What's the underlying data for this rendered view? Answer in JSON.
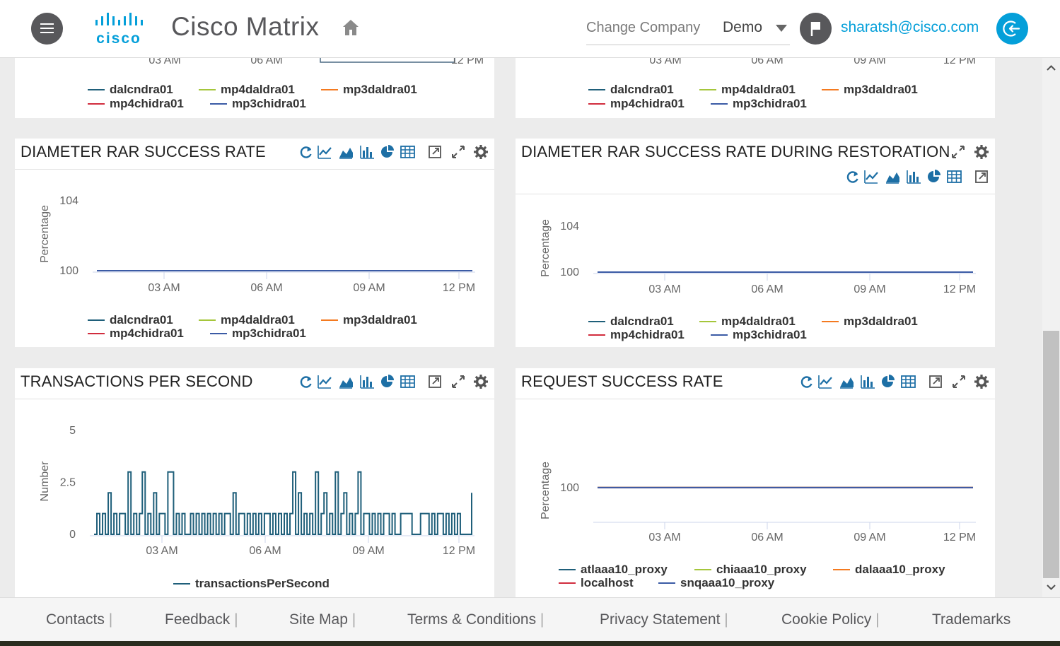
{
  "header": {
    "app_title": "Cisco Matrix",
    "logo_text": "cisco",
    "company_label": "Change Company",
    "company_value": "Demo",
    "user_email": "sharatsh@cisco.com"
  },
  "panels": {
    "top_left": {
      "legend": [
        "dalcndra01",
        "mp4daldra01",
        "mp3daldra01",
        "mp4chidra01",
        "mp3chidra01"
      ],
      "x_ticks_partial": [
        "03 AM",
        "06 AM",
        "09 AM",
        "12 PM"
      ]
    },
    "top_right": {
      "legend": [
        "dalcndra01",
        "mp4daldra01",
        "mp3daldra01",
        "mp4chidra01",
        "mp3chidra01"
      ],
      "x_ticks_partial": [
        "03 AM",
        "06 AM",
        "09 AM",
        "12 PM"
      ]
    },
    "rar_success": {
      "title": "DIAMETER RAR SUCCESS RATE",
      "legend": [
        "dalcndra01",
        "mp4daldra01",
        "mp3daldra01",
        "mp4chidra01",
        "mp3chidra01"
      ]
    },
    "rar_restoration": {
      "title": "DIAMETER RAR SUCCESS RATE DURING RESTORATION",
      "legend": [
        "dalcndra01",
        "mp4daldra01",
        "mp3daldra01",
        "mp4chidra01",
        "mp3chidra01"
      ]
    },
    "tps": {
      "title": "TRANSACTIONS PER SECOND",
      "legend": [
        "transactionsPerSecond"
      ]
    },
    "request_success": {
      "title": "REQUEST SUCCESS RATE",
      "legend": [
        "atlaaa10_proxy",
        "chiaaa10_proxy",
        "dalaaa10_proxy",
        "localhost",
        "snqaaa10_proxy"
      ]
    }
  },
  "chart_data": [
    {
      "type": "line",
      "ylabel": "Percentage",
      "x_ticks": [
        "03 AM",
        "06 AM",
        "09 AM",
        "12 PM"
      ],
      "y_ticks": [
        100,
        104
      ],
      "ylim": [
        100,
        104
      ],
      "series": [
        {
          "name": "dalcndra01",
          "color": "#1f5f7a",
          "values": [
            100,
            100
          ]
        },
        {
          "name": "mp4daldra01",
          "color": "#a5c63b",
          "values": [
            100,
            100
          ]
        },
        {
          "name": "mp3daldra01",
          "color": "#f47a20",
          "values": [
            100,
            100
          ]
        },
        {
          "name": "mp4chidra01",
          "color": "#d12d3e",
          "values": [
            100,
            100
          ]
        },
        {
          "name": "mp3chidra01",
          "color": "#3b5ba5",
          "values": [
            100,
            100
          ]
        }
      ]
    },
    {
      "type": "line",
      "ylabel": "Percentage",
      "x_ticks": [
        "03 AM",
        "06 AM",
        "09 AM",
        "12 PM"
      ],
      "y_ticks": [
        100,
        104
      ],
      "ylim": [
        100,
        104
      ],
      "series": [
        {
          "name": "dalcndra01",
          "color": "#1f5f7a",
          "values": [
            100,
            100
          ]
        },
        {
          "name": "mp4daldra01",
          "color": "#a5c63b",
          "values": [
            100,
            100
          ]
        },
        {
          "name": "mp3daldra01",
          "color": "#f47a20",
          "values": [
            100,
            100
          ]
        },
        {
          "name": "mp4chidra01",
          "color": "#d12d3e",
          "values": [
            100,
            100
          ]
        },
        {
          "name": "mp3chidra01",
          "color": "#3b5ba5",
          "values": [
            100,
            100
          ]
        }
      ]
    },
    {
      "type": "line",
      "ylabel": "Number",
      "x_ticks": [
        "03 AM",
        "06 AM",
        "09 AM",
        "12 PM"
      ],
      "y_ticks": [
        "0",
        "2.5",
        "5"
      ],
      "ylim": [
        0,
        5
      ],
      "series": [
        {
          "name": "transactionsPerSecond",
          "color": "#1f5f7a",
          "values": [
            0,
            1,
            0,
            1,
            0,
            2,
            0,
            1,
            0,
            1,
            1,
            0,
            3,
            0,
            1,
            0,
            1,
            3,
            0,
            1,
            0,
            2,
            0,
            1,
            1,
            0,
            3,
            3,
            0,
            1,
            0,
            1,
            0,
            0,
            1,
            0,
            1,
            0,
            1,
            0,
            1,
            0,
            1,
            0,
            1,
            0,
            1,
            1,
            0,
            2,
            0,
            1,
            1,
            0,
            1,
            0,
            1,
            0,
            1,
            0,
            1,
            1,
            0,
            1,
            0,
            1,
            0,
            1,
            0,
            1,
            3,
            0,
            2,
            0,
            1,
            0,
            1,
            0,
            3,
            0,
            1,
            2,
            0,
            1,
            0,
            3,
            0,
            1,
            2,
            0,
            1,
            0,
            1,
            3,
            0,
            1,
            1,
            0,
            1,
            0,
            1,
            0,
            1,
            1,
            0,
            1,
            0,
            0,
            1,
            1,
            1,
            1,
            0,
            0,
            0,
            1,
            1,
            1,
            0,
            1,
            0,
            1,
            1,
            0,
            1,
            0,
            1,
            0,
            1,
            0,
            0,
            0,
            0,
            2
          ]
        }
      ]
    },
    {
      "type": "line",
      "ylabel": "Percentage",
      "x_ticks": [
        "03 AM",
        "06 AM",
        "09 AM",
        "12 PM"
      ],
      "y_ticks": [
        100
      ],
      "ylim": [
        95,
        102
      ],
      "series": [
        {
          "name": "atlaaa10_proxy",
          "color": "#1f5f7a",
          "values": [
            100,
            100
          ]
        },
        {
          "name": "chiaaa10_proxy",
          "color": "#a5c63b",
          "values": [
            100,
            100
          ]
        },
        {
          "name": "dalaaa10_proxy",
          "color": "#f47a20",
          "values": [
            100,
            100
          ]
        },
        {
          "name": "localhost",
          "color": "#d12d3e",
          "values": [
            100,
            100
          ]
        },
        {
          "name": "snqaaa10_proxy",
          "color": "#3b5ba5",
          "values": [
            100,
            100
          ]
        }
      ]
    }
  ],
  "footer": {
    "links": [
      "Contacts",
      "Feedback",
      "Site Map",
      "Terms & Conditions",
      "Privacy Statement",
      "Cookie Policy",
      "Trademarks"
    ],
    "separator": "|"
  },
  "colors": {
    "accent": "#049fd9",
    "icon": "#1d6fa5",
    "header_gray": "#58585b"
  }
}
